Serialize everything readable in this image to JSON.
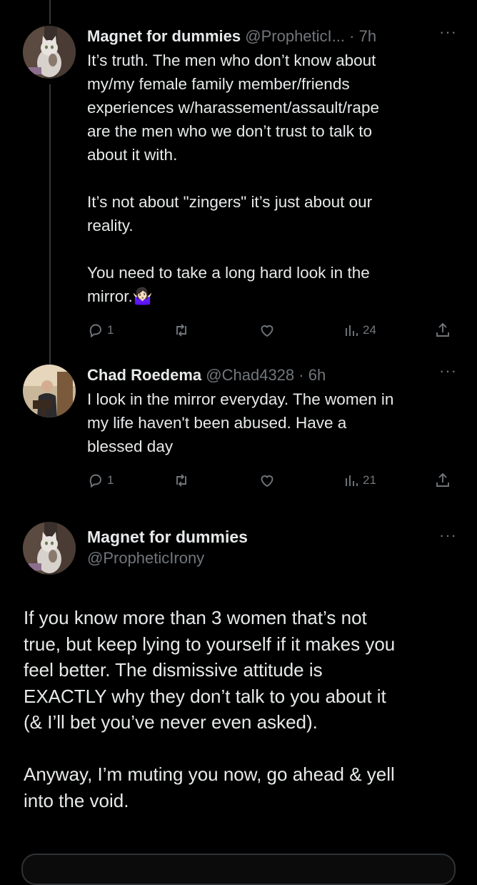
{
  "tweets": [
    {
      "name": "Magnet for dummies",
      "handle": "@PropheticI...",
      "dot": "·",
      "time": "7h",
      "more": "···",
      "text": "It’s truth. The men who don’t know about\nmy/my female family member/friends\nexperiences w/harassement/assault/rape\nare the men who we don’t trust to talk to\nabout it with.\n\nIt’s not about \"zingers\" it’s just about our\nreality.\n\nYou need to take a long hard look in the\nmirror.🤷🏻‍♀️",
      "replies": "1",
      "retweets": "",
      "likes": "",
      "views": "24"
    },
    {
      "name": "Chad Roedema",
      "handle": "@Chad4328",
      "dot": "·",
      "time": "6h",
      "more": "···",
      "text": "I look in the mirror everyday. The women in\nmy life haven't been abused. Have a\nblessed day",
      "replies": "1",
      "retweets": "",
      "likes": "",
      "views": "21"
    }
  ],
  "focal": {
    "name": "Magnet for dummies",
    "handle": "@PropheticIrony",
    "more": "···",
    "text": "If you know more than 3 women that’s not\ntrue, but keep lying to yourself if it makes you\nfeel better. The dismissive attitude is\nEXACTLY why they don’t talk to you about it\n(& I’ll bet you’ve never even asked).\n\nAnyway, I’m muting you now, go ahead & yell\ninto the void."
  },
  "colors": {
    "background": "#000000",
    "text": "#e7e9ea",
    "secondary": "#71767b",
    "thread_line": "#333639"
  }
}
